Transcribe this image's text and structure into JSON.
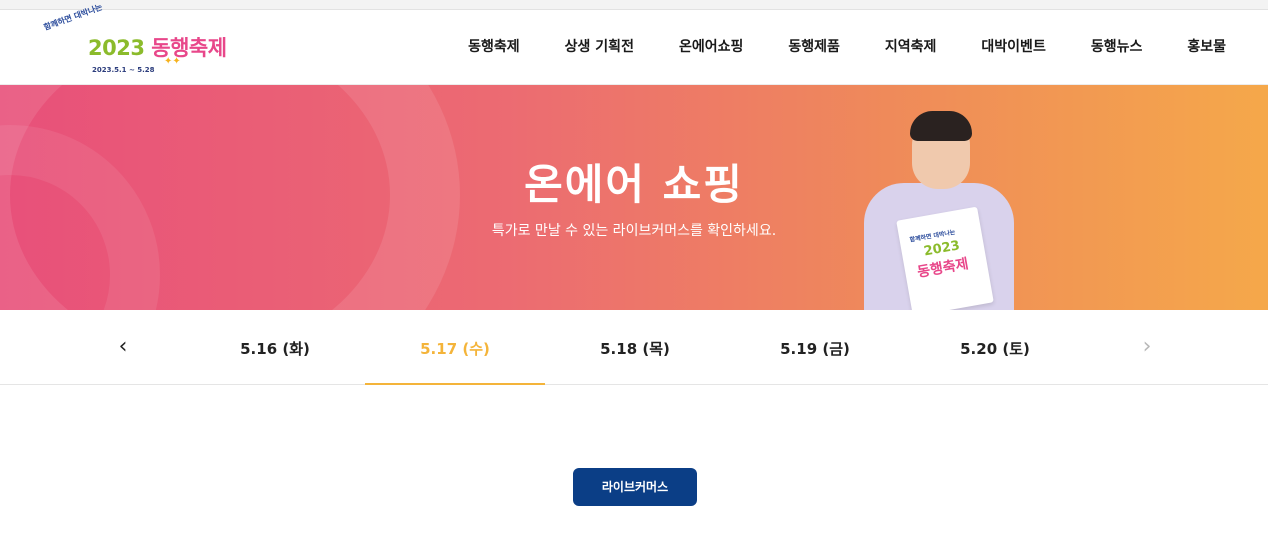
{
  "logo": {
    "tagline": "함께하면 대박나는",
    "year": "2023",
    "title": "동행축제",
    "dates": "2023.5.1 ~ 5.28",
    "stars": "✦✦"
  },
  "nav": {
    "items": [
      {
        "label": "동행축제"
      },
      {
        "label": "상생 기획전"
      },
      {
        "label": "온에어쇼핑"
      },
      {
        "label": "동행제품"
      },
      {
        "label": "지역축제"
      },
      {
        "label": "대박이벤트"
      },
      {
        "label": "동행뉴스"
      },
      {
        "label": "홍보물"
      }
    ]
  },
  "banner": {
    "title": "온에어 쇼핑",
    "subtitle": "특가로 만날 수 있는 라이브커머스를 확인하세요.",
    "bag": {
      "tagline": "함께하면 대박나는",
      "year": "2023",
      "title": "동행축제"
    }
  },
  "date_tabs": {
    "prev_icon": "‹",
    "next_icon": "›",
    "items": [
      {
        "label": "5.16 (화)"
      },
      {
        "label": "5.17 (수)"
      },
      {
        "label": "5.18 (목)"
      },
      {
        "label": "5.19 (금)"
      },
      {
        "label": "5.20 (토)"
      }
    ],
    "active_index": 1,
    "active_color": "#f4b43a"
  },
  "content": {
    "button_label": "라이브커머스",
    "button_color": "#0b3e86"
  },
  "colors": {
    "banner_start": "#e8507a",
    "banner_end": "#f5a84a"
  }
}
